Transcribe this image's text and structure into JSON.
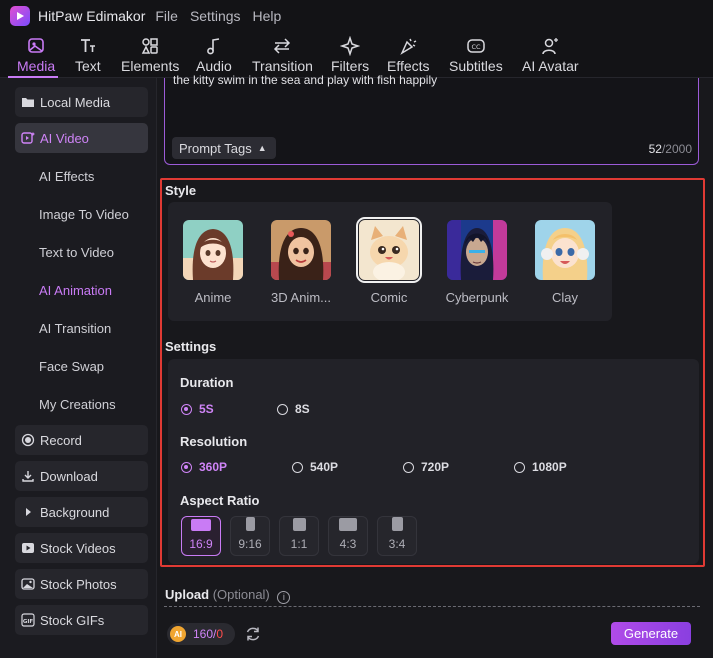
{
  "app": {
    "title": "HitPaw Edimakor",
    "menu": [
      "File",
      "Settings",
      "Help"
    ]
  },
  "toolbar": {
    "tabs": [
      {
        "label": "Media",
        "icon": "media-icon",
        "active": true
      },
      {
        "label": "Text",
        "icon": "text-icon"
      },
      {
        "label": "Elements",
        "icon": "elements-icon"
      },
      {
        "label": "Audio",
        "icon": "audio-icon"
      },
      {
        "label": "Transition",
        "icon": "transition-icon"
      },
      {
        "label": "Filters",
        "icon": "filters-icon"
      },
      {
        "label": "Effects",
        "icon": "effects-icon"
      },
      {
        "label": "Subtitles",
        "icon": "subtitles-icon"
      },
      {
        "label": "AI Avatar",
        "icon": "ai-avatar-icon"
      }
    ]
  },
  "sidebar": {
    "local_media": "Local Media",
    "ai_video": "AI Video",
    "sub_items": [
      "AI Effects",
      "Image To Video",
      "Text to Video",
      "AI Animation",
      "AI Transition",
      "Face Swap",
      "My Creations"
    ],
    "active_sub": "AI Animation",
    "bottom_items": [
      "Record",
      "Download",
      "Background",
      "Stock Videos",
      "Stock Photos",
      "Stock GIFs"
    ]
  },
  "prompt": {
    "text": "the kitty swim in the sea and play with fish happily",
    "tags_label": "Prompt Tags",
    "count_current": "52",
    "count_max": "/2000"
  },
  "style": {
    "title": "Style",
    "options": [
      "Anime",
      "3D Anim...",
      "Comic",
      "Cyberpunk",
      "Clay"
    ],
    "selected": "Comic"
  },
  "settings": {
    "title": "Settings",
    "duration": {
      "label": "Duration",
      "options": [
        "5S",
        "8S"
      ],
      "selected": "5S"
    },
    "resolution": {
      "label": "Resolution",
      "options": [
        "360P",
        "540P",
        "720P",
        "1080P"
      ],
      "selected": "360P"
    },
    "aspect_ratio": {
      "label": "Aspect Ratio",
      "options": [
        "16:9",
        "9:16",
        "1:1",
        "4:3",
        "3:4"
      ],
      "selected": "16:9"
    }
  },
  "upload": {
    "label": "Upload",
    "optional": "(Optional)"
  },
  "footer": {
    "coin_label": "AI",
    "credits": "160/",
    "credits_zero": "0",
    "generate_label": "Generate"
  },
  "colors": {
    "accent": "#c97bf5",
    "highlight_frame": "#e03a34",
    "background": "#18181c"
  }
}
